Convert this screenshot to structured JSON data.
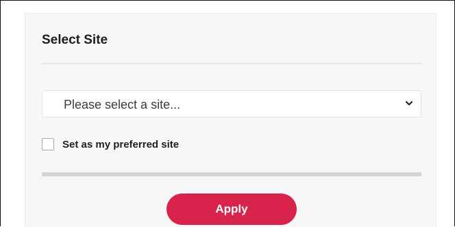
{
  "panel": {
    "title": "Select Site"
  },
  "site_select": {
    "selected_value": "Please select a site...",
    "icon": "chevron-down-icon"
  },
  "preferred_checkbox": {
    "label": "Set as my preferred site",
    "checked": false
  },
  "apply_button": {
    "label": "Apply",
    "color": "#d8234d"
  }
}
